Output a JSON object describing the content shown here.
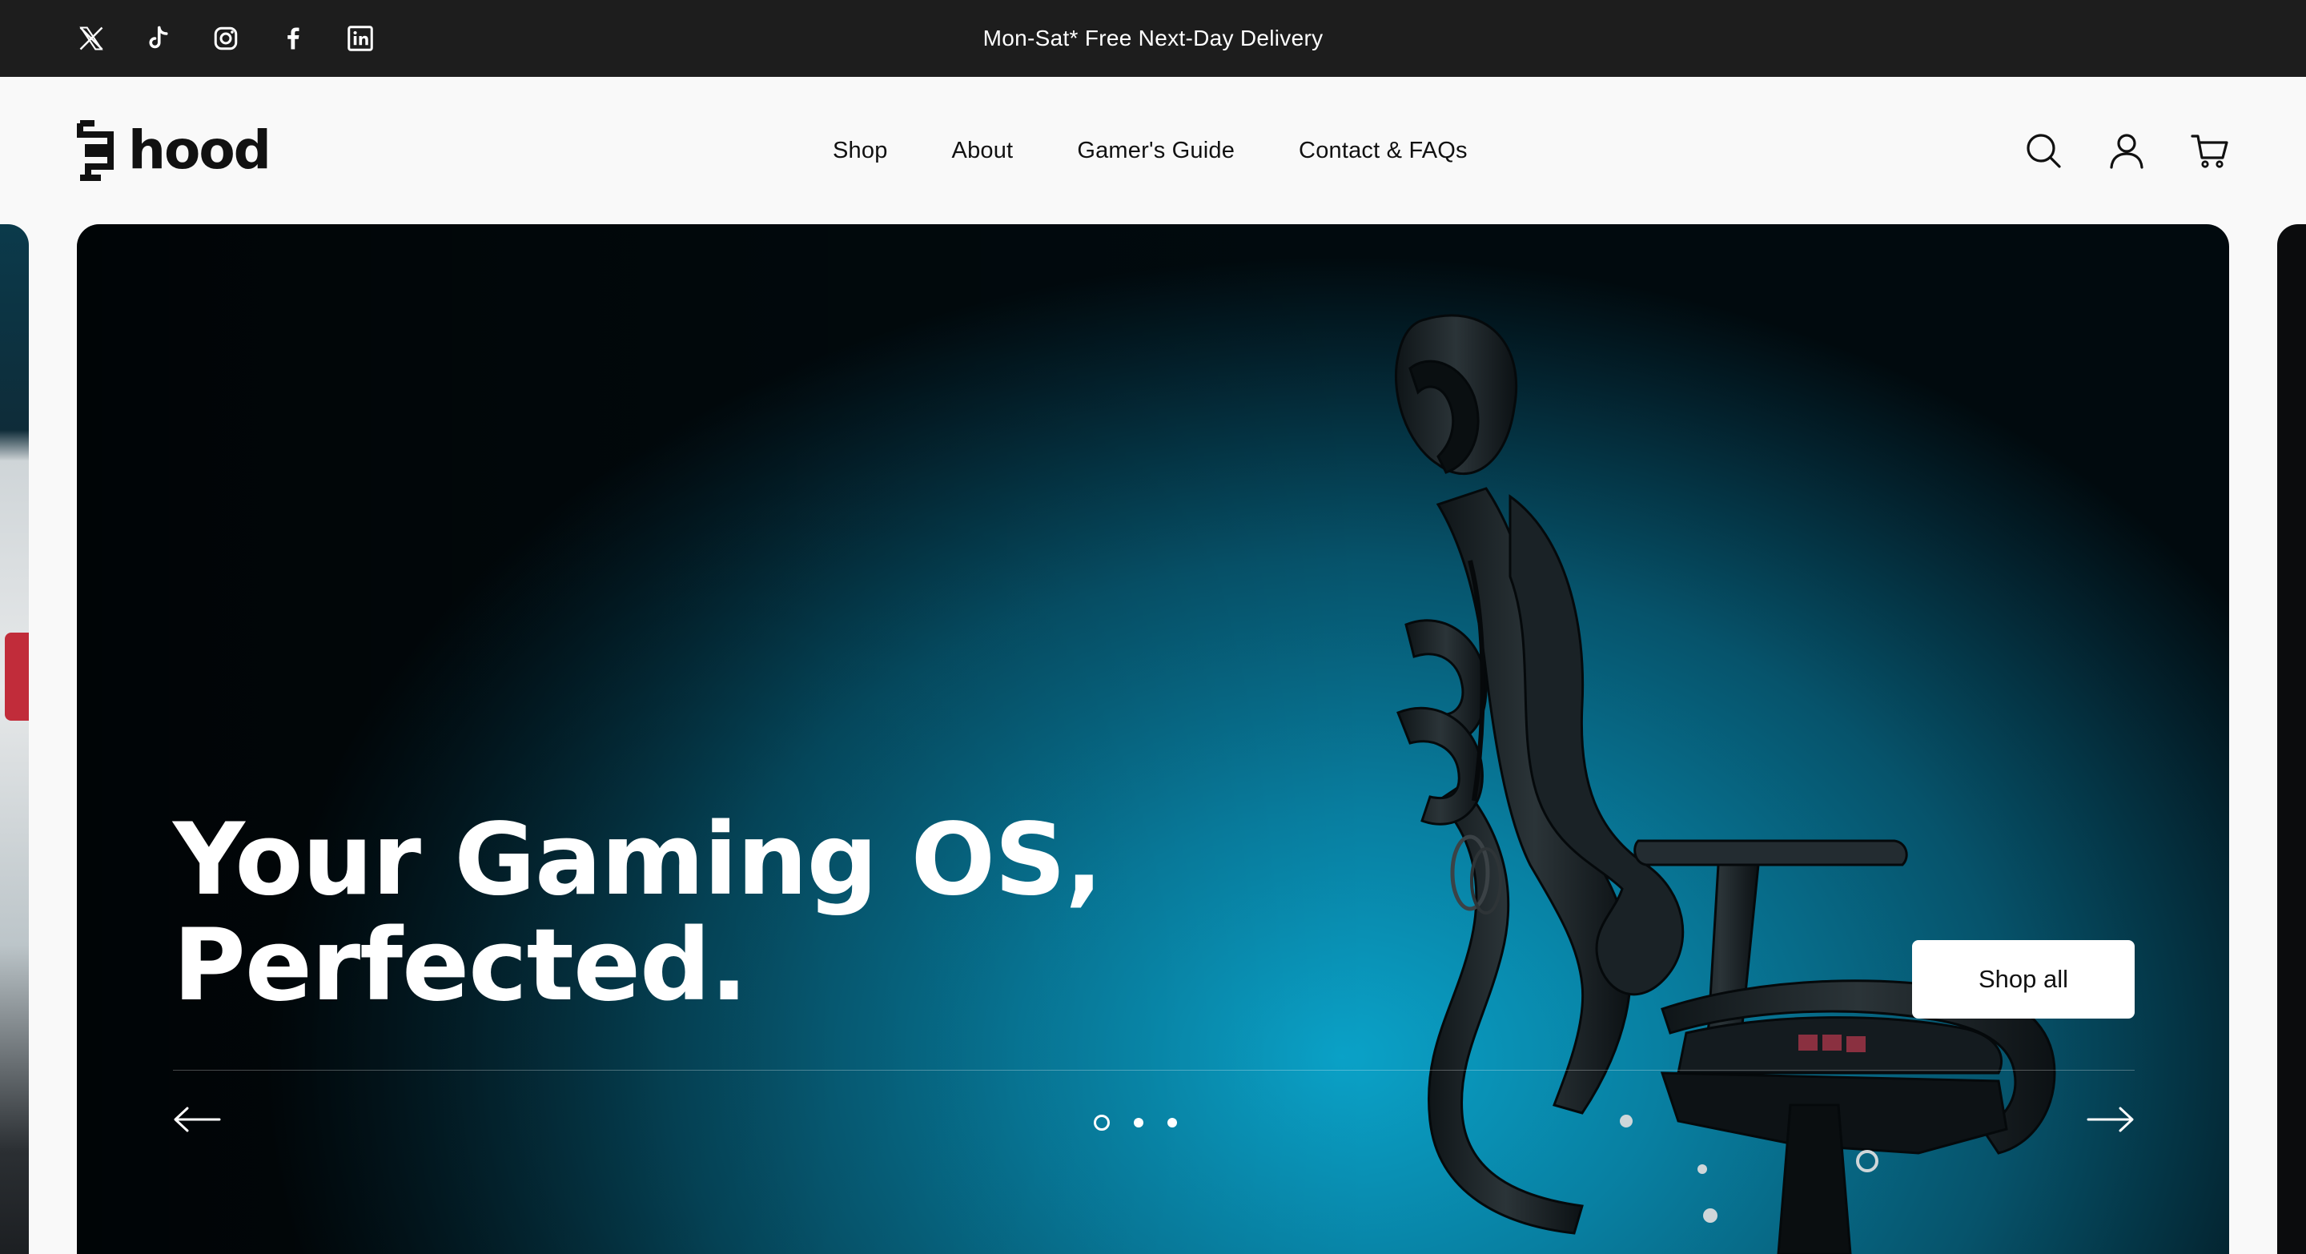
{
  "announcement": {
    "text": "Mon-Sat* Free Next-Day Delivery",
    "social_icons": [
      "x-icon",
      "tiktok-icon",
      "instagram-icon",
      "facebook-icon",
      "linkedin-icon"
    ]
  },
  "header": {
    "logo_text": "hood",
    "nav": [
      {
        "label": "Shop"
      },
      {
        "label": "About"
      },
      {
        "label": "Gamer's Guide"
      },
      {
        "label": "Contact & FAQs"
      }
    ],
    "icons": [
      "search-icon",
      "account-icon",
      "cart-icon"
    ]
  },
  "hero": {
    "title_line1": "Your Gaming OS,",
    "title_line2": "Perfected.",
    "cta_label": "Shop all",
    "slide_count": 3,
    "active_slide": 1,
    "colors": {
      "background_center": "#0aa2c8",
      "background_edge": "#010a0e",
      "cta_background": "#ffffff"
    }
  },
  "colors": {
    "announcement_bar": "#1d1d1d",
    "header_background": "#f9f9f9",
    "text": "#111111"
  }
}
